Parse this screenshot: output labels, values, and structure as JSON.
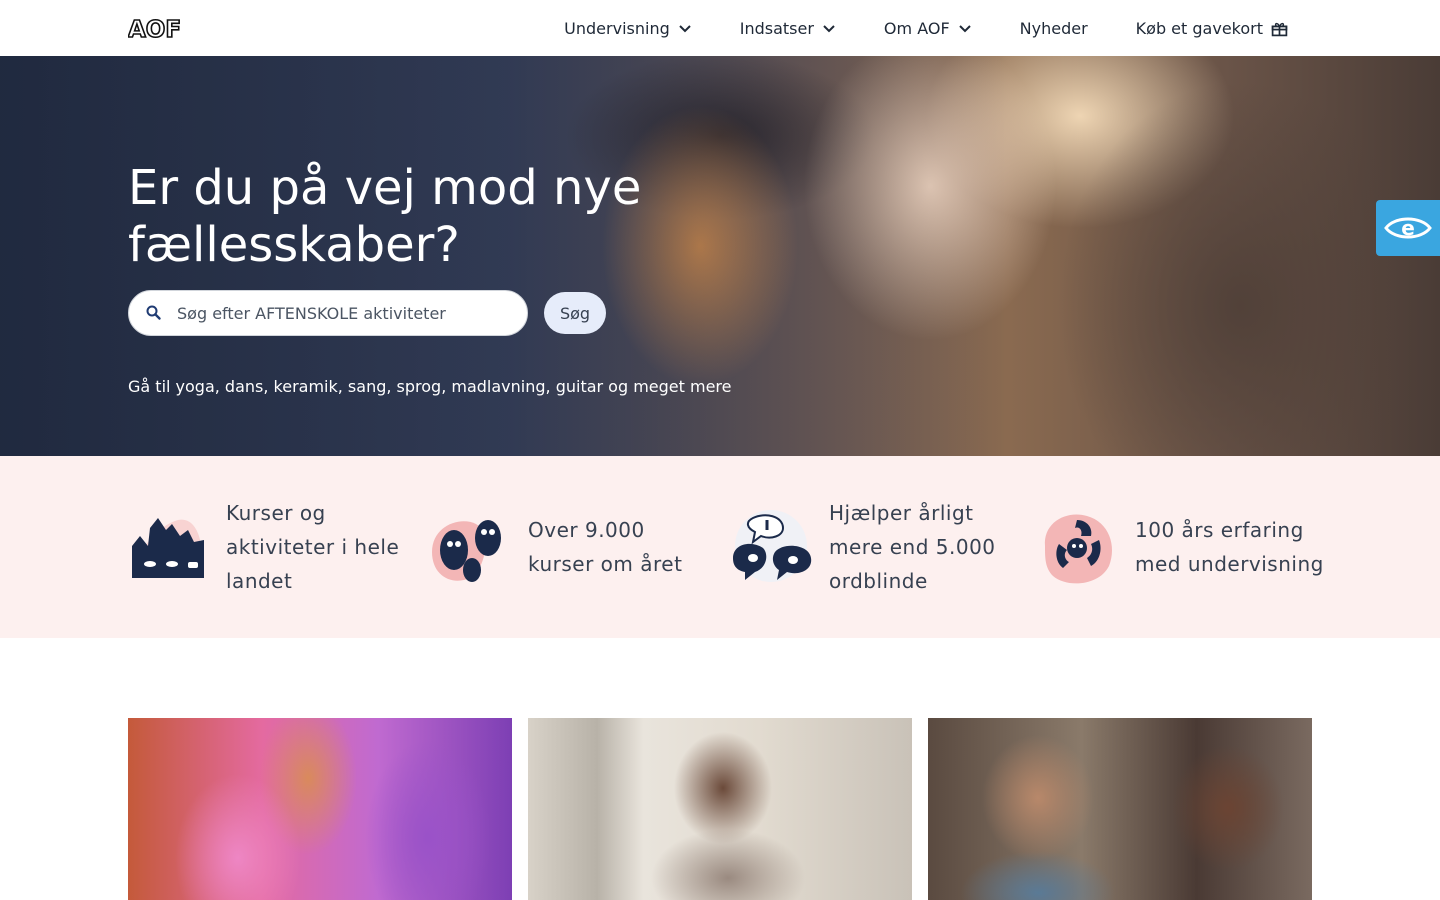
{
  "header": {
    "logo_text": "AOF",
    "nav": [
      {
        "label": "Undervisning",
        "has_dropdown": true
      },
      {
        "label": "Indsatser",
        "has_dropdown": true
      },
      {
        "label": "Om AOF",
        "has_dropdown": true
      },
      {
        "label": "Nyheder",
        "has_dropdown": false
      },
      {
        "label": "Køb et gavekort",
        "icon": "gift-icon"
      }
    ]
  },
  "hero": {
    "title": "Er du på vej mod nye fællesskaber?",
    "search": {
      "placeholder": "Søg efter AFTENSKOLE aktiviteter",
      "value": "",
      "button_label": "Søg"
    },
    "subtitle": "Gå til yoga, dans, keramik, sang, sprog, madlavning, guitar og meget mere"
  },
  "accessibility_widget": {
    "icon": "eye-icon",
    "color": "#3aa6e0"
  },
  "features": [
    {
      "text": "Kurser og aktiviteter i hele landet",
      "icon": "town-illustration-icon"
    },
    {
      "text": "Over 9.000 kurser om året",
      "icon": "creatures-illustration-icon"
    },
    {
      "text": "Hjælper årligt mere end 5.000 ordblinde",
      "icon": "speech-bubbles-illustration-icon"
    },
    {
      "text": "100 års erfaring med undervisning",
      "icon": "circle-figures-illustration-icon"
    }
  ],
  "colors": {
    "features_bg": "#fdf0ef",
    "illustration_navy": "#1b2a4a",
    "illustration_pink": "#f3b6b6"
  }
}
